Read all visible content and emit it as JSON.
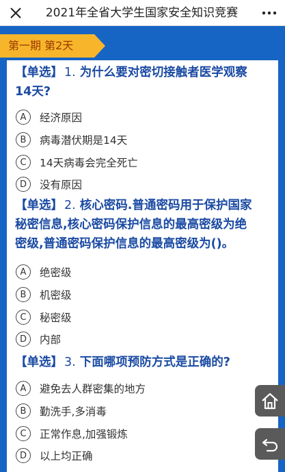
{
  "header": {
    "title": "2021年全省大学生国家安全知识竞赛",
    "close_icon": "close-icon",
    "more_icon": "more-dots-icon"
  },
  "period_tag": "第一期 第2天",
  "questions": [
    {
      "type": "【单选】",
      "number": "1.",
      "line1": "为什么要对密切接触者医学观察",
      "line2": "14天?",
      "options": [
        {
          "letter": "A",
          "text": "经济原因"
        },
        {
          "letter": "B",
          "text": "病毒潜伏期是14天"
        },
        {
          "letter": "C",
          "text": "14天病毒会完全死亡"
        },
        {
          "letter": "D",
          "text": "没有原因"
        }
      ]
    },
    {
      "type": "【单选】",
      "number": "2.",
      "line1": "核心密码.普通密码用于保护国家",
      "line2": "秘密信息,核心密码保护信息的最高密级为绝",
      "line3": "密级,普通密码保护信息的最高密级为()。",
      "options": [
        {
          "letter": "A",
          "text": "绝密级"
        },
        {
          "letter": "B",
          "text": "机密级"
        },
        {
          "letter": "C",
          "text": "秘密级"
        },
        {
          "letter": "D",
          "text": "内部"
        }
      ]
    },
    {
      "type": "【单选】",
      "number": "3.",
      "line1": "下面哪项预防方式是正确的?",
      "options": [
        {
          "letter": "A",
          "text": "避免去人群密集的地方"
        },
        {
          "letter": "B",
          "text": "勤洗手,多消毒"
        },
        {
          "letter": "C",
          "text": "正常作息,加强锻炼"
        },
        {
          "letter": "D",
          "text": "以上均正确"
        }
      ]
    }
  ],
  "floating": {
    "home_icon": "home-icon",
    "back_icon": "back-icon"
  },
  "colors": {
    "background": "#1665c4",
    "tag": "#f7b52c",
    "question_text": "#1a4aa3"
  }
}
